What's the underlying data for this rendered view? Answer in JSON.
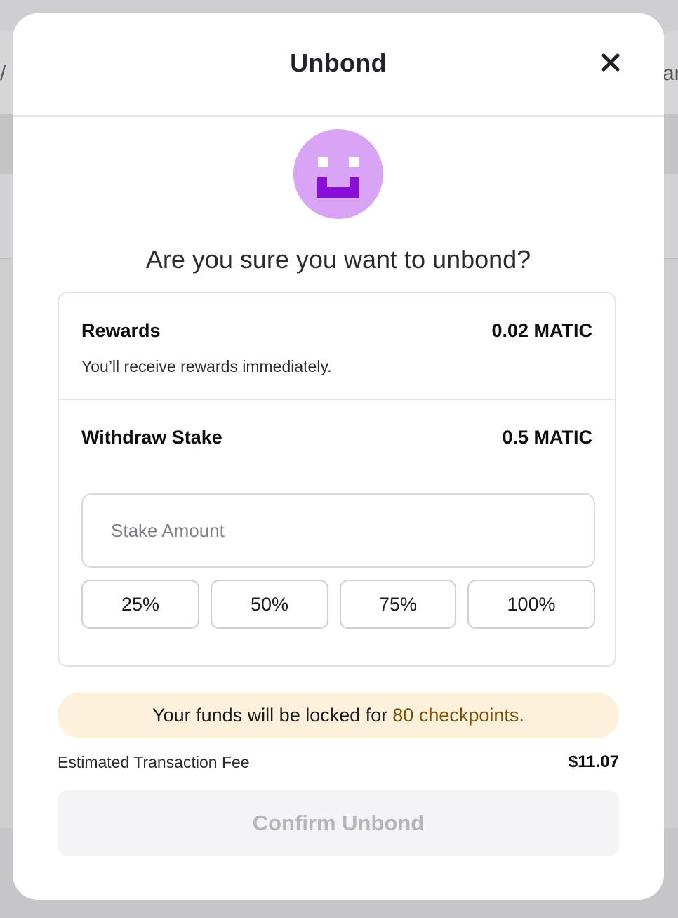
{
  "background": {
    "left_fragment": "/",
    "right_fragment": "ar"
  },
  "modal": {
    "title": "Unbond",
    "close_icon": "close-icon",
    "avatar_icon": "smiley-face-icon",
    "question": "Are you sure you want to unbond?",
    "rewards": {
      "label": "Rewards",
      "value": "0.02 MATIC",
      "note": "You’ll receive rewards immediately."
    },
    "withdraw": {
      "label": "Withdraw Stake",
      "value": "0.5 MATIC",
      "input_placeholder": "Stake Amount",
      "input_value": "",
      "percent_options": [
        "25%",
        "50%",
        "75%",
        "100%"
      ]
    },
    "notice": {
      "text": "Your funds will be locked for",
      "highlight": "80 checkpoints."
    },
    "fee": {
      "label": "Estimated Transaction Fee",
      "value": "$11.07"
    },
    "confirm_label": "Confirm Unbond"
  },
  "colors": {
    "avatar_bg": "#d9a4f4",
    "avatar_face": "#8a0fd6",
    "notice_bg": "#fdf1dc",
    "notice_highlight": "#7a4f06",
    "confirm_disabled_text": "#b5b5bb"
  }
}
